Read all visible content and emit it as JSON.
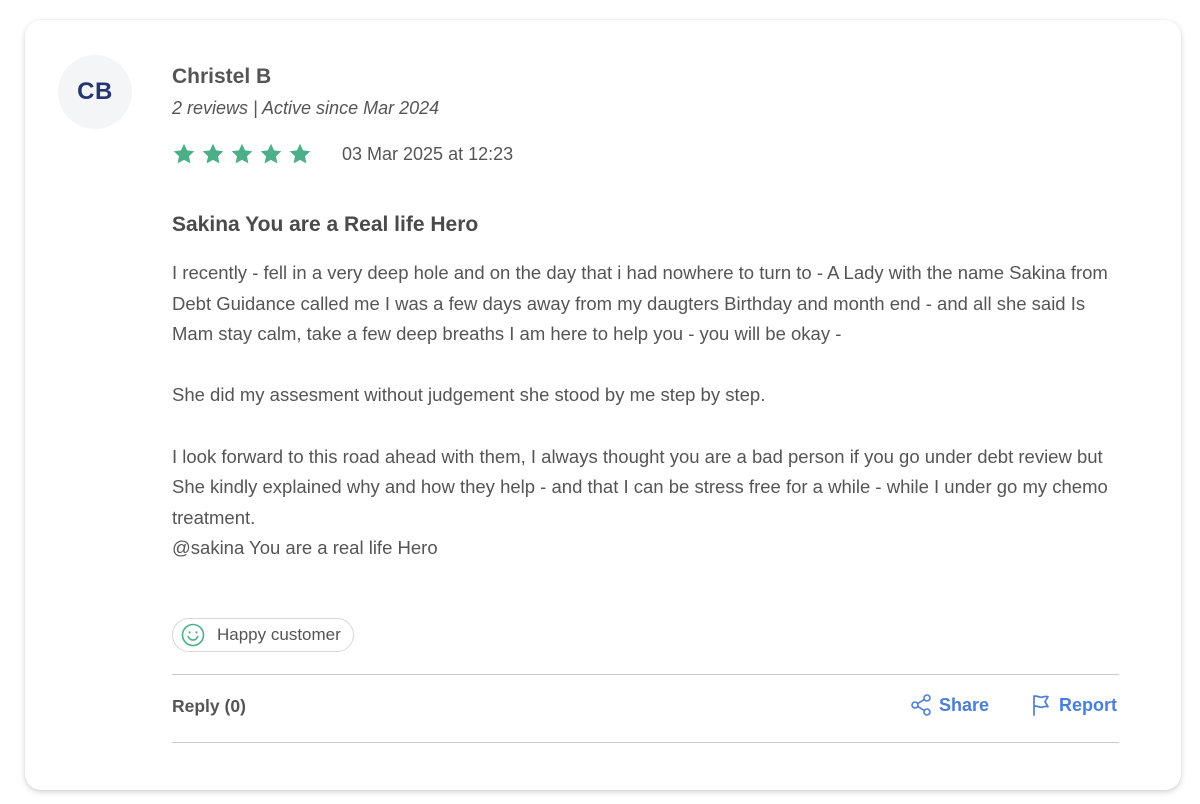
{
  "reviewer": {
    "initials": "CB",
    "name": "Christel B",
    "meta": "2 reviews | Active since Mar 2024"
  },
  "review": {
    "rating": 5,
    "rating_max": 5,
    "star_color": "#4caf87",
    "date": "03 Mar 2025 at 12:23",
    "title": "Sakina You are a Real life Hero",
    "paragraphs": [
      "I recently - fell in a very deep hole and on the day that i had nowhere to turn to - A Lady with the name Sakina from Debt Guidance called me I was a few days away from my daugters Birthday and month end - and all she said Is Mam stay calm, take a few deep breaths I am here to help you - you will be okay -",
      "She did my assesment without judgement she stood by me step by step.",
      "I look forward to this road ahead with them, I always thought you are a bad person if you go under debt review but She kindly explained why and how they help - and that I can be stress free for a while - while I under go my chemo treatment.",
      "@sakina You are a real life Hero"
    ],
    "sentiment": {
      "icon": "smiley-icon",
      "label": "Happy customer",
      "color": "#4caf87"
    }
  },
  "actions": {
    "reply_label": "Reply (0)",
    "share_label": "Share",
    "report_label": "Report",
    "accent_color": "#4a7fd6"
  }
}
